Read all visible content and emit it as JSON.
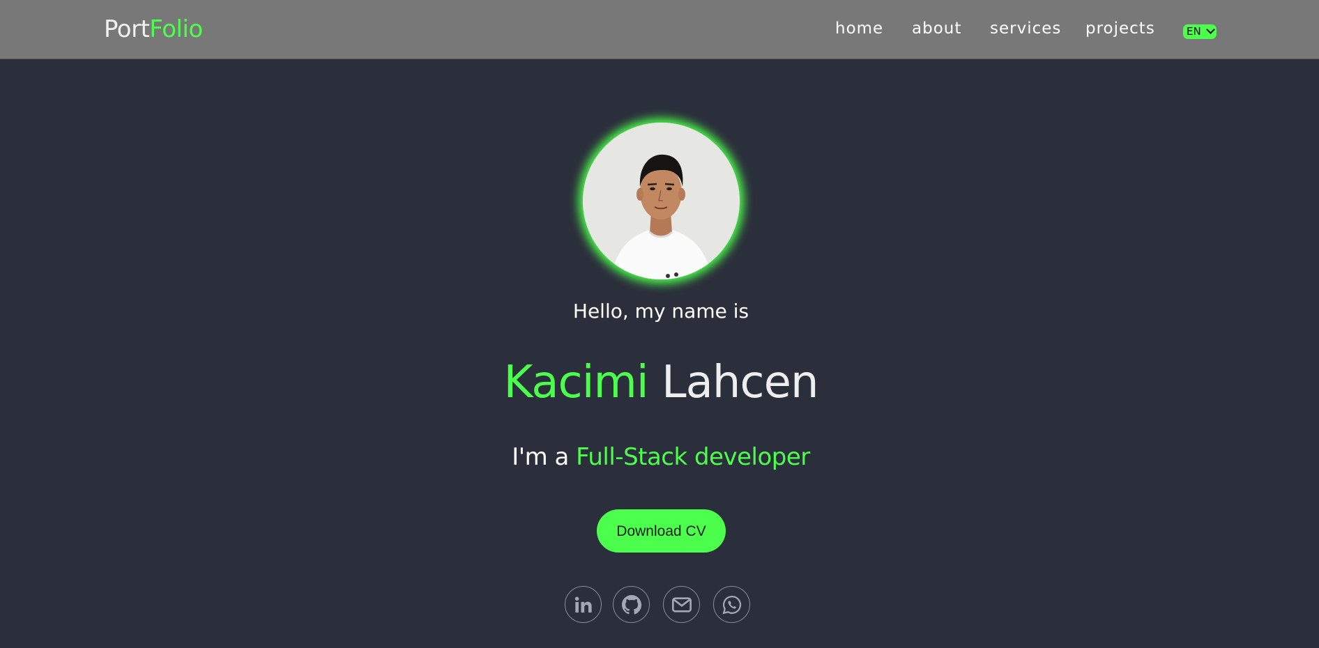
{
  "header": {
    "logo_part1": "Port",
    "logo_part2": "Folio",
    "nav": {
      "home": "home",
      "about": "about",
      "services": "services",
      "projects": "projects"
    },
    "language": "EN"
  },
  "hero": {
    "greeting": "Hello, my name is",
    "first_name": "Kacimi",
    "last_name": "Lahcen",
    "role_prefix": "I'm a",
    "role": "Full-Stack developer",
    "cv_button": "Download CV"
  },
  "social_icons": [
    "linkedin-icon",
    "github-icon",
    "mail-icon",
    "whatsapp-icon"
  ],
  "colors": {
    "accent": "#4dff4d",
    "background": "#2b2f3b",
    "navbar": "#787878"
  }
}
